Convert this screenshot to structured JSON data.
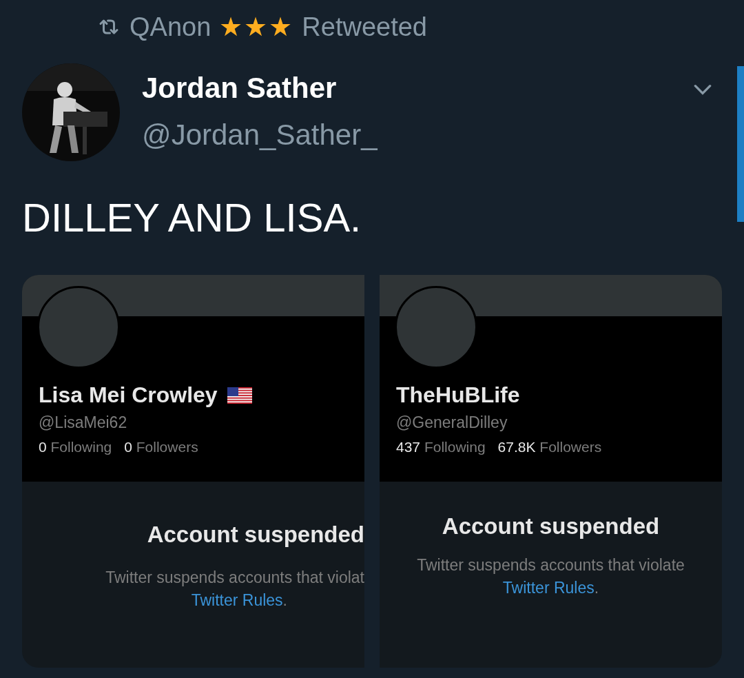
{
  "retweet_line": {
    "retweeter": "QAnon",
    "emoji": "★★★",
    "label": "Retweeted"
  },
  "tweet": {
    "author": {
      "kind": "picture",
      "name": "Jordan Sather",
      "handle": "@Jordan_Sather_"
    },
    "text": "DILLEY AND LISA.",
    "cards": [
      {
        "name": "Lisa Mei Crowley",
        "flag": true,
        "handle": "@LisaMei62",
        "following_count": "0",
        "following_label": "Following",
        "followers_count": "0",
        "followers_label": "Followers",
        "heading": "Account suspended",
        "body": "Twitter suspends accounts that violat",
        "link": "Twitter Rules",
        "link_end": "."
      },
      {
        "name": "TheHuBLife",
        "flag": false,
        "handle": "@GeneralDilley",
        "following_count": "437",
        "following_label": "Following",
        "followers_count": "67.8K",
        "followers_label": "Followers",
        "heading": "Account suspended",
        "body": "Twitter suspends accounts that violate",
        "link": "Twitter Rules",
        "link_end": "."
      }
    ]
  }
}
